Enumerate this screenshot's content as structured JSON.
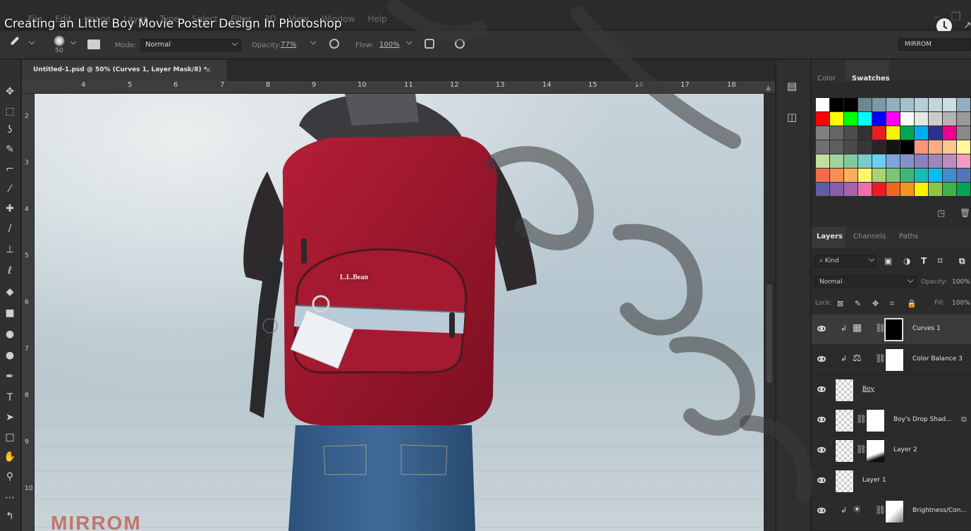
{
  "video": {
    "title": "Creating an Little Boy Movie Poster Design In Photoshop"
  },
  "menu": {
    "items": [
      "File",
      "Edit",
      "Image",
      "Layer",
      "Type",
      "Select",
      "Filter",
      "3D",
      "View",
      "Window",
      "Help"
    ]
  },
  "options": {
    "brush_size": "50",
    "mode_label": "Mode:",
    "mode_value": "Normal",
    "opacity_label": "Opacity:",
    "opacity_value": "77%",
    "flow_label": "Flow:",
    "flow_value": "100%",
    "workspace": "MIRROM"
  },
  "document": {
    "tab_title": "Untitled-1.psd @ 50% (Curves 1, Layer Mask/8) *",
    "close_glyph": "×",
    "ruler_top": [
      "4",
      "5",
      "6",
      "7",
      "8",
      "9",
      "10",
      "11",
      "12",
      "13",
      "14",
      "15",
      "16",
      "17",
      "18"
    ],
    "ruler_left": [
      "2",
      "3",
      "4",
      "5",
      "6",
      "7",
      "8",
      "9",
      "10"
    ],
    "canvas_watermark": "MIRROM"
  },
  "panels": {
    "color_tab": "Color",
    "swatches_tab": "Swatches",
    "layers_tab": "Layers",
    "channels_tab": "Channels",
    "paths_tab": "Paths",
    "kind_label": "Kind",
    "blend_mode": "Normal",
    "opacity_label": "Opacity:",
    "opacity_value": "100%",
    "lock_label": "Lock:",
    "fill_label": "Fill:",
    "fill_value": "100%"
  },
  "layers": [
    {
      "name": "Curves 1",
      "type": "adjustment",
      "adj_icon": "curves-icon",
      "selected": true,
      "clipped": true
    },
    {
      "name": "Color Balance 3",
      "type": "adjustment",
      "adj_icon": "scales-icon",
      "selected": false,
      "clipped": true
    },
    {
      "name": "Boy",
      "type": "smart",
      "selected": false,
      "clipped": false
    },
    {
      "name": "Boy's Drop Shad...",
      "type": "masked",
      "selected": false,
      "clipped": false
    },
    {
      "name": "Layer 2",
      "type": "masked",
      "selected": false,
      "clipped": false
    },
    {
      "name": "Layer 1",
      "type": "pixel",
      "selected": false,
      "clipped": false
    },
    {
      "name": "Brightness/Con...",
      "type": "adjustment",
      "adj_icon": "sun-icon",
      "selected": false,
      "clipped": true
    }
  ],
  "colors": {
    "ui_dark": "#2b2b2b",
    "ui_panel": "#323232",
    "accent_watermark": "#c0604d"
  }
}
